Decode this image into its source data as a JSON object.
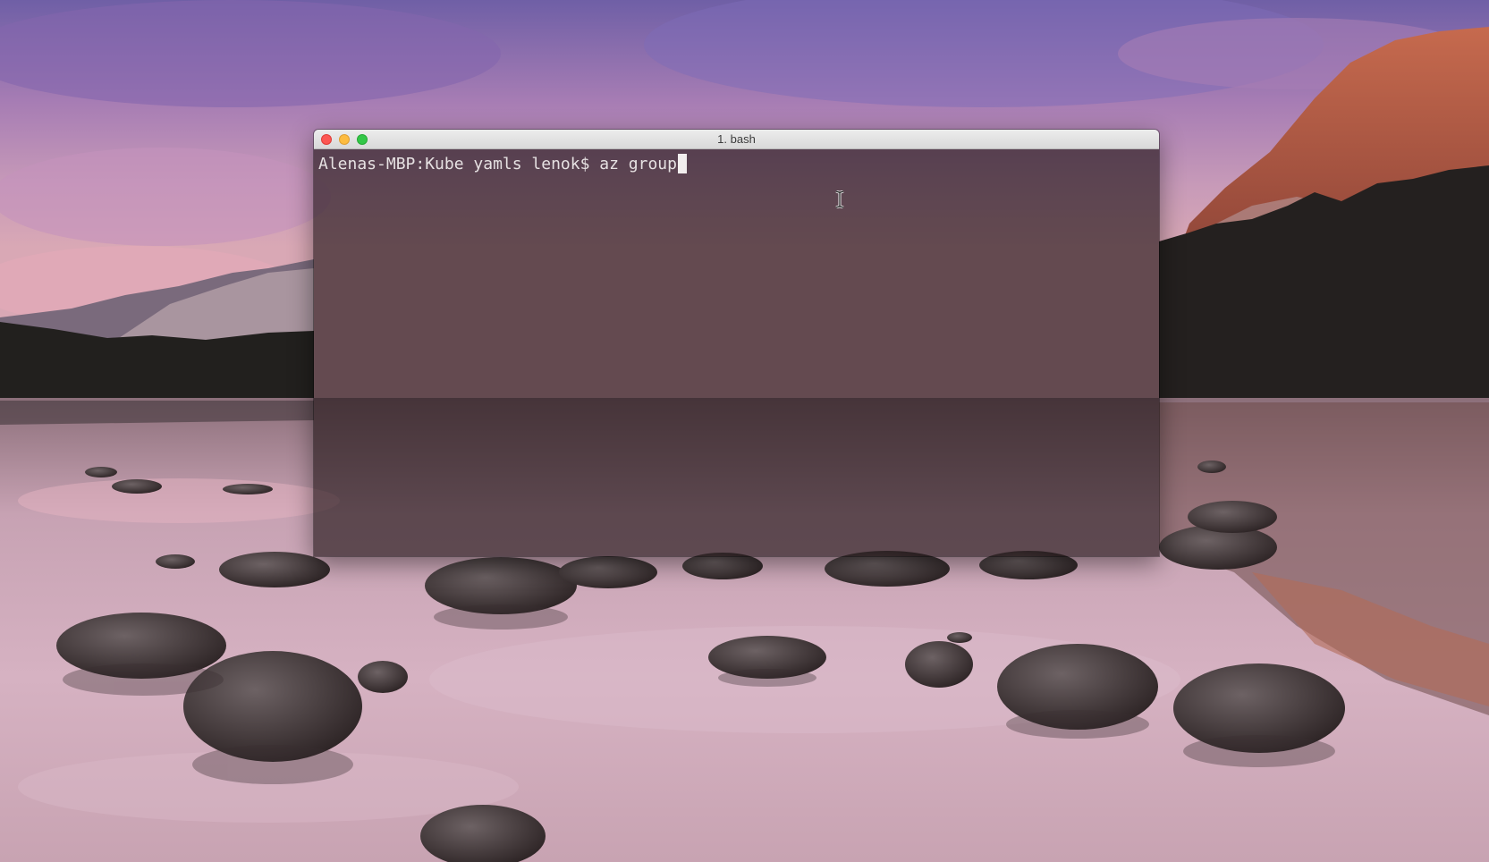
{
  "window": {
    "title": "1. bash"
  },
  "terminal": {
    "prompt": "Alenas-MBP:Kube yamls lenok$ ",
    "input": "az group"
  },
  "controls": {
    "close_color": "#fc5753",
    "minimize_color": "#fdbc40",
    "maximize_color": "#33c748"
  },
  "icons": {
    "close": "close-icon",
    "minimize": "minimize-icon",
    "maximize": "maximize-icon",
    "pointer": "text-cursor-icon"
  }
}
